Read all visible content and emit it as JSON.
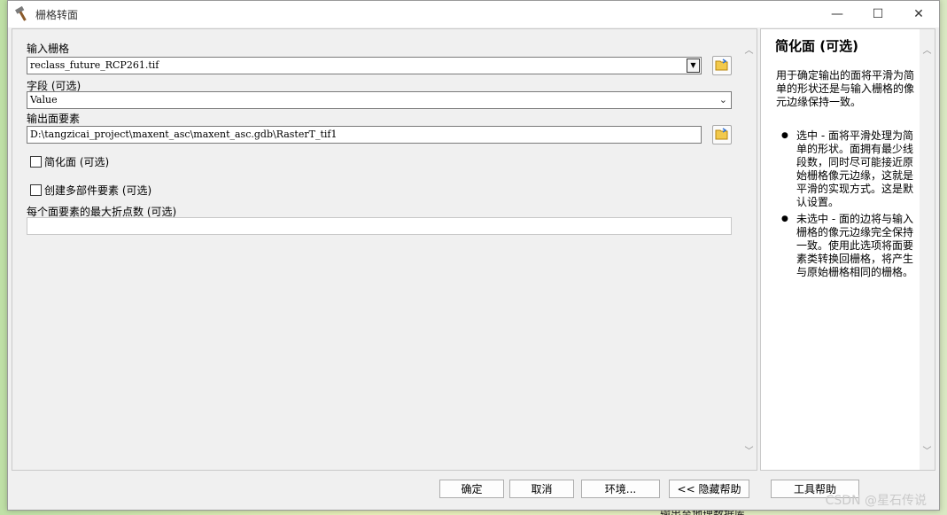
{
  "window": {
    "title": "栅格转面"
  },
  "form": {
    "input_raster": {
      "label": "输入栅格",
      "value": "reclass_future_RCP261.tif"
    },
    "field": {
      "label": "字段 (可选)",
      "value": "Value"
    },
    "output": {
      "label": "输出面要素",
      "value": "D:\\tangzicai_project\\maxent_asc\\maxent_asc.gdb\\RasterT_tif1"
    },
    "simplify": {
      "label": "简化面 (可选)",
      "checked": false
    },
    "multipart": {
      "label": "创建多部件要素 (可选)",
      "checked": false
    },
    "max_vertices": {
      "label": "每个面要素的最大折点数 (可选)",
      "value": ""
    }
  },
  "help": {
    "title": "简化面 (可选)",
    "description": "用于确定输出的面将平滑为简单的形状还是与输入栅格的像元边缘保持一致。",
    "items": [
      "选中 - 面将平滑处理为简单的形状。面拥有最少线段数，同时尽可能接近原始栅格像元边缘，这就是平滑的实现方式。这是默认设置。",
      "未选中 - 面的边将与输入栅格的像元边缘完全保持一致。使用此选项将面要素类转换回栅格，将产生与原始栅格相同的栅格。"
    ]
  },
  "buttons": {
    "ok": "确定",
    "cancel": "取消",
    "env": "环境...",
    "hide_help": "<< 隐藏帮助",
    "tool_help": "工具帮助"
  },
  "background": {
    "bottom_text": "输出至地理数据库"
  },
  "watermark": "CSDN @星石传说"
}
